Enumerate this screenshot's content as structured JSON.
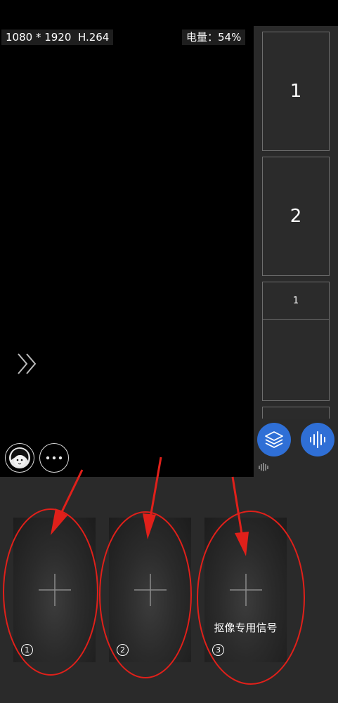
{
  "preview": {
    "resolution": "1080 * 1920",
    "codec": "H.264",
    "battery": "电量：54%"
  },
  "side_panel": {
    "slots": [
      {
        "label": "1"
      },
      {
        "label": "2"
      },
      {
        "label": "1"
      }
    ]
  },
  "buttons": {
    "layers_icon": "layers-icon",
    "audio_icon": "sound-wave-icon",
    "avatar_icon": "beauty-avatar-icon",
    "more_icon": "more-dots-icon",
    "expand_icon": "double-chevron-right-icon"
  },
  "cards": [
    {
      "index": "1",
      "label": ""
    },
    {
      "index": "2",
      "label": ""
    },
    {
      "index": "3",
      "label": "抠像专用信号"
    }
  ],
  "colors": {
    "accent": "#2f6fd6",
    "annotation": "#e0201a"
  }
}
